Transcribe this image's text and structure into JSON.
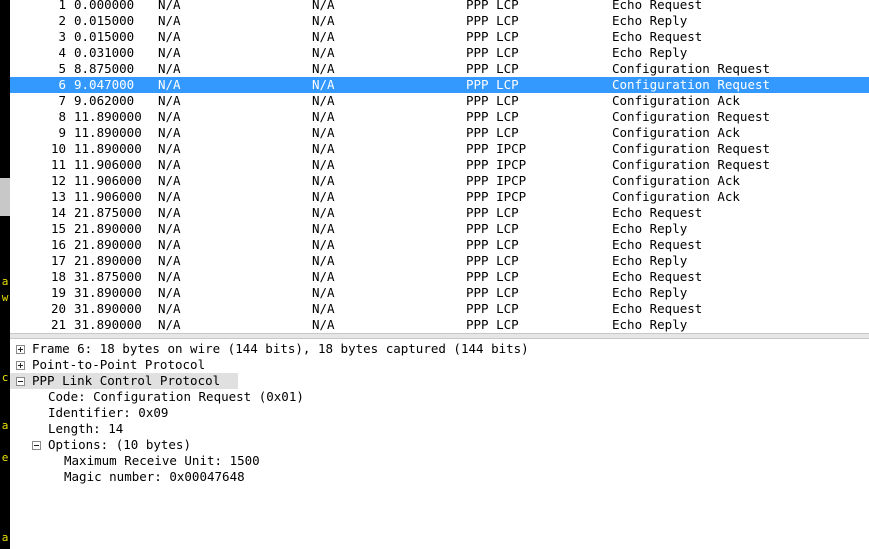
{
  "left_strip": {
    "letters": [
      "a",
      "w",
      "c",
      "a",
      "e",
      "a"
    ]
  },
  "packets": [
    {
      "no": "1",
      "time": "0.000000",
      "source": "N/A",
      "destination": "N/A",
      "protocol": "PPP LCP",
      "info": "Echo Request"
    },
    {
      "no": "2",
      "time": "0.015000",
      "source": "N/A",
      "destination": "N/A",
      "protocol": "PPP LCP",
      "info": "Echo Reply"
    },
    {
      "no": "3",
      "time": "0.015000",
      "source": "N/A",
      "destination": "N/A",
      "protocol": "PPP LCP",
      "info": "Echo Request"
    },
    {
      "no": "4",
      "time": "0.031000",
      "source": "N/A",
      "destination": "N/A",
      "protocol": "PPP LCP",
      "info": "Echo Reply"
    },
    {
      "no": "5",
      "time": "8.875000",
      "source": "N/A",
      "destination": "N/A",
      "protocol": "PPP LCP",
      "info": "Configuration Request"
    },
    {
      "no": "6",
      "time": "9.047000",
      "source": "N/A",
      "destination": "N/A",
      "protocol": "PPP LCP",
      "info": "Configuration Request",
      "selected": true
    },
    {
      "no": "7",
      "time": "9.062000",
      "source": "N/A",
      "destination": "N/A",
      "protocol": "PPP LCP",
      "info": "Configuration Ack"
    },
    {
      "no": "8",
      "time": "11.890000",
      "source": "N/A",
      "destination": "N/A",
      "protocol": "PPP LCP",
      "info": "Configuration Request"
    },
    {
      "no": "9",
      "time": "11.890000",
      "source": "N/A",
      "destination": "N/A",
      "protocol": "PPP LCP",
      "info": "Configuration Ack"
    },
    {
      "no": "10",
      "time": "11.890000",
      "source": "N/A",
      "destination": "N/A",
      "protocol": "PPP IPCP",
      "info": "Configuration Request"
    },
    {
      "no": "11",
      "time": "11.906000",
      "source": "N/A",
      "destination": "N/A",
      "protocol": "PPP IPCP",
      "info": "Configuration Request"
    },
    {
      "no": "12",
      "time": "11.906000",
      "source": "N/A",
      "destination": "N/A",
      "protocol": "PPP IPCP",
      "info": "Configuration Ack"
    },
    {
      "no": "13",
      "time": "11.906000",
      "source": "N/A",
      "destination": "N/A",
      "protocol": "PPP IPCP",
      "info": "Configuration Ack"
    },
    {
      "no": "14",
      "time": "21.875000",
      "source": "N/A",
      "destination": "N/A",
      "protocol": "PPP LCP",
      "info": "Echo Request"
    },
    {
      "no": "15",
      "time": "21.890000",
      "source": "N/A",
      "destination": "N/A",
      "protocol": "PPP LCP",
      "info": "Echo Reply"
    },
    {
      "no": "16",
      "time": "21.890000",
      "source": "N/A",
      "destination": "N/A",
      "protocol": "PPP LCP",
      "info": "Echo Request"
    },
    {
      "no": "17",
      "time": "21.890000",
      "source": "N/A",
      "destination": "N/A",
      "protocol": "PPP LCP",
      "info": "Echo Reply"
    },
    {
      "no": "18",
      "time": "31.875000",
      "source": "N/A",
      "destination": "N/A",
      "protocol": "PPP LCP",
      "info": "Echo Request"
    },
    {
      "no": "19",
      "time": "31.890000",
      "source": "N/A",
      "destination": "N/A",
      "protocol": "PPP LCP",
      "info": "Echo Reply"
    },
    {
      "no": "20",
      "time": "31.890000",
      "source": "N/A",
      "destination": "N/A",
      "protocol": "PPP LCP",
      "info": "Echo Request"
    },
    {
      "no": "21",
      "time": "31.890000",
      "source": "N/A",
      "destination": "N/A",
      "protocol": "PPP LCP",
      "info": "Echo Reply"
    }
  ],
  "details": [
    {
      "text": "Frame 6: 18 bytes on wire (144 bits), 18 bytes captured (144 bits)",
      "depth": 0,
      "expander": "plus"
    },
    {
      "text": "Point-to-Point Protocol",
      "depth": 0,
      "expander": "plus"
    },
    {
      "text": "PPP Link Control Protocol",
      "depth": 0,
      "expander": "minus",
      "selected": true
    },
    {
      "text": "Code: Configuration Request (0x01)",
      "depth": 1,
      "expander": "none"
    },
    {
      "text": "Identifier: 0x09",
      "depth": 1,
      "expander": "none"
    },
    {
      "text": "Length: 14",
      "depth": 1,
      "expander": "none"
    },
    {
      "text": "Options: (10 bytes)",
      "depth": 1,
      "expander": "minus"
    },
    {
      "text": "Maximum Receive Unit: 1500",
      "depth": 2,
      "expander": "none"
    },
    {
      "text": "Magic number: 0x00047648",
      "depth": 2,
      "expander": "none"
    }
  ]
}
